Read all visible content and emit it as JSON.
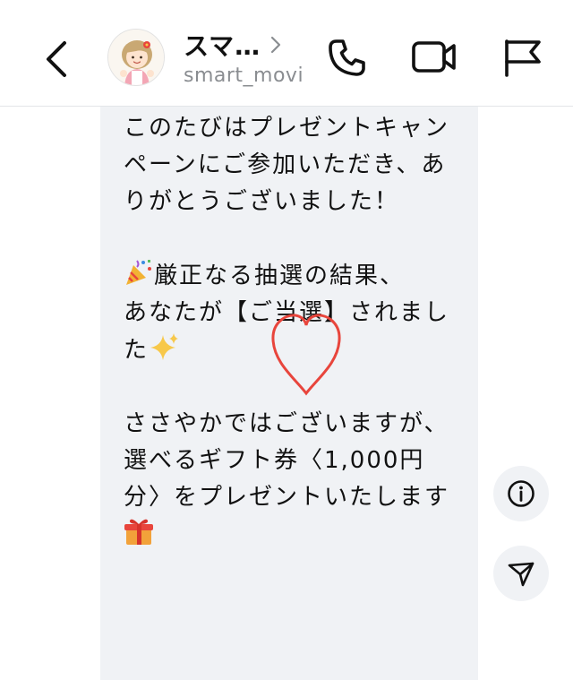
{
  "header": {
    "contact_name": "スマ…",
    "handle": "smart_movi",
    "icons": {
      "back": "chevron-left-icon",
      "profile_chevron": "chevron-right-icon",
      "call": "phone-icon",
      "video": "video-camera-icon",
      "report": "flag-icon"
    }
  },
  "message": {
    "paragraph_1": "このたびはプレゼントキャンペーンにご参加いただき、ありがとうございました！",
    "paragraph_2_line_1": "厳正なる抽選の結果、",
    "paragraph_2_line_2": "あなたが【ご当選】されました",
    "paragraph_3_line_1": "ささやかではございますが、",
    "paragraph_3_line_2": "選べるギフト券〈1,000円分〉をプレゼントいたします",
    "emojis": [
      "party-popper-icon",
      "sparkles-icon",
      "gift-icon"
    ]
  },
  "overlay": {
    "icon": "heart-outline-icon",
    "color": "#e8453c"
  },
  "actions": {
    "info": "info-icon",
    "send": "send-icon"
  },
  "colors": {
    "bubble": "#f0f2f5",
    "heart": "#e8453c",
    "secondary_text": "#8a8d91"
  }
}
